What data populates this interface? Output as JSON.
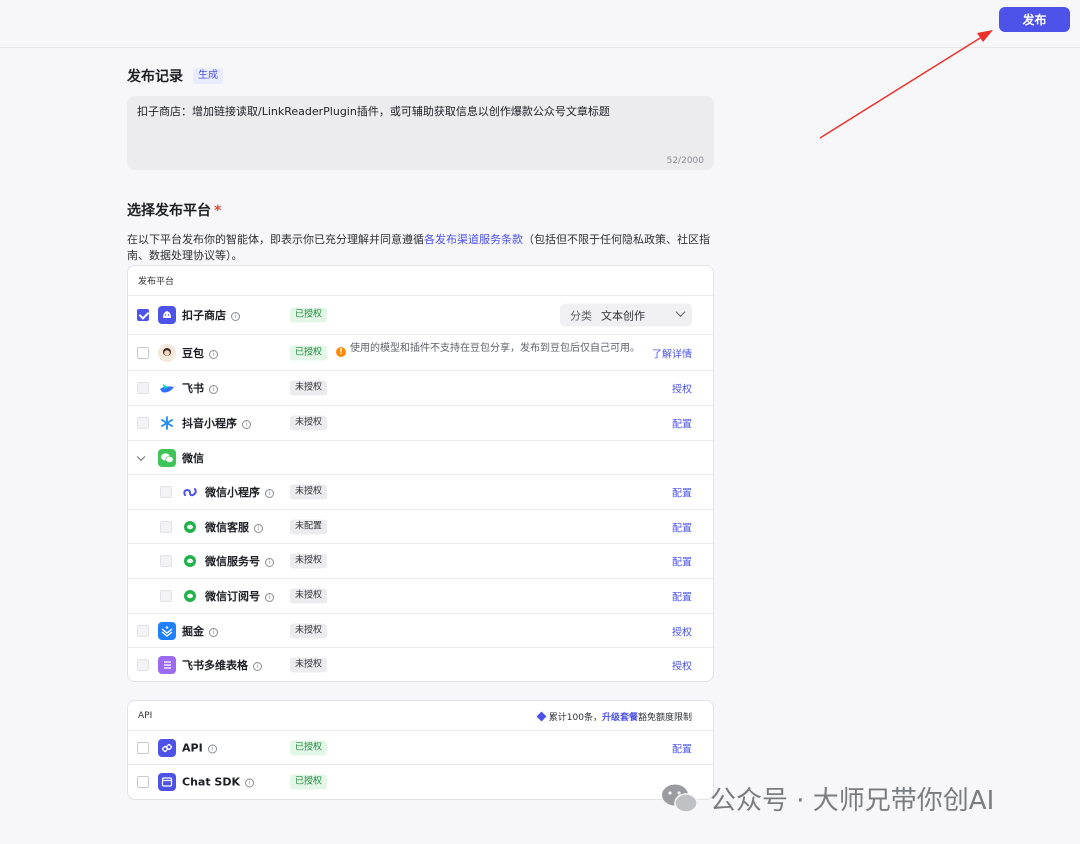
{
  "header": {
    "publish_label": "发布"
  },
  "record": {
    "title": "发布记录",
    "generate_label": "生成",
    "text": "扣子商店：增加链接读取/LinkReaderPlugin插件，或可辅助获取信息以创作爆款公众号文章标题",
    "count": "52/2000"
  },
  "platform_section": {
    "title": "选择发布平台",
    "required_mark": "*",
    "desc_before": "在以下平台发布你的智能体，即表示你已充分理解并同意遵循",
    "desc_link": "各发布渠道服务条款",
    "desc_after": "（包括但不限于任何隐私政策、社区指南、数据处理协议等）。"
  },
  "platforms": {
    "header": "发布平台",
    "coze_store": {
      "name": "扣子商店",
      "status": "已授权",
      "category_label": "分类",
      "category_value": "文本创作"
    },
    "doubao": {
      "name": "豆包",
      "status": "已授权",
      "warning": "使用的模型和插件不支持在豆包分享，发布到豆包后仅自己可用。",
      "action": "了解详情"
    },
    "feishu": {
      "name": "飞书",
      "status": "未授权",
      "action": "授权"
    },
    "douyin": {
      "name": "抖音小程序",
      "status": "未授权",
      "action": "配置"
    },
    "wechat": {
      "name": "微信"
    },
    "wechat_mini": {
      "name": "微信小程序",
      "status": "未授权",
      "action": "配置"
    },
    "wechat_cs": {
      "name": "微信客服",
      "status": "未配置",
      "action": "配置"
    },
    "wechat_service": {
      "name": "微信服务号",
      "status": "未授权",
      "action": "配置"
    },
    "wechat_sub": {
      "name": "微信订阅号",
      "status": "未授权",
      "action": "配置"
    },
    "juejin": {
      "name": "掘金",
      "status": "未授权",
      "action": "授权"
    },
    "feishu_table": {
      "name": "飞书多维表格",
      "status": "未授权",
      "action": "授权"
    }
  },
  "api": {
    "header": "API",
    "quota_text": "累计100条，",
    "quota_link": "升级套餐",
    "quota_after": "豁免额度限制",
    "api_row": {
      "name": "API",
      "status": "已授权",
      "action": "配置"
    },
    "sdk_row": {
      "name": "Chat SDK",
      "status": "已授权"
    }
  },
  "watermark": {
    "text": "公众号 · 大师兄带你创AI"
  },
  "colors": {
    "accent": "#4d53e8",
    "authorized_bg": "#e3f6e7",
    "authorized_text": "#1d8a3a",
    "arrow": "#e8322b"
  },
  "icons": [
    "coze-store-icon",
    "doubao-icon",
    "feishu-icon",
    "douyin-icon",
    "wechat-icon",
    "wechat-mini-icon",
    "wechat-cs-icon",
    "juejin-icon",
    "feishu-table-icon",
    "api-icon",
    "sdk-icon",
    "info-icon",
    "warning-icon",
    "chevron-down-icon",
    "gem-icon"
  ]
}
